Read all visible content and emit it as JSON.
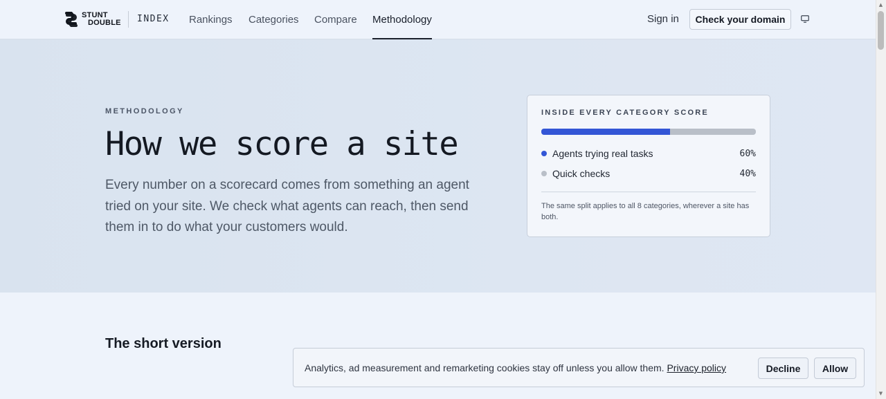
{
  "header": {
    "logo_line1": "STUNT",
    "logo_line2": "DOUBLE",
    "index_label": "INDEX",
    "nav": [
      {
        "label": "Rankings"
      },
      {
        "label": "Categories"
      },
      {
        "label": "Compare"
      },
      {
        "label": "Methodology",
        "active": true
      }
    ],
    "sign_in": "Sign in",
    "cta": "Check your domain",
    "display_icon": "monitor-icon"
  },
  "hero": {
    "eyebrow": "METHODOLOGY",
    "title": "How we score a site",
    "lead": "Every number on a scorecard comes from something an agent tried on your site. We check what agents can reach, then send them in to do what your customers would."
  },
  "split_card": {
    "title": "INSIDE EVERY CATEGORY SCORE",
    "bar_fraction": 0.6,
    "rows": [
      {
        "label": "Agents trying real tasks",
        "value": "60%",
        "color": "#3356d6"
      },
      {
        "label": "Quick checks",
        "value": "40%",
        "color": "#b9bfc8"
      }
    ],
    "note": "The same split applies to all 8 categories, wherever a site has both."
  },
  "section": {
    "title": "The short version"
  },
  "cookie": {
    "text": "Analytics, ad measurement and remarketing cookies stay off unless you allow them.",
    "link": "Privacy policy",
    "decline": "Decline",
    "allow": "Allow"
  },
  "colors": {
    "accent": "#3356d6",
    "hero_bg": "#dde6f2",
    "page_bg": "#eef3fb"
  }
}
